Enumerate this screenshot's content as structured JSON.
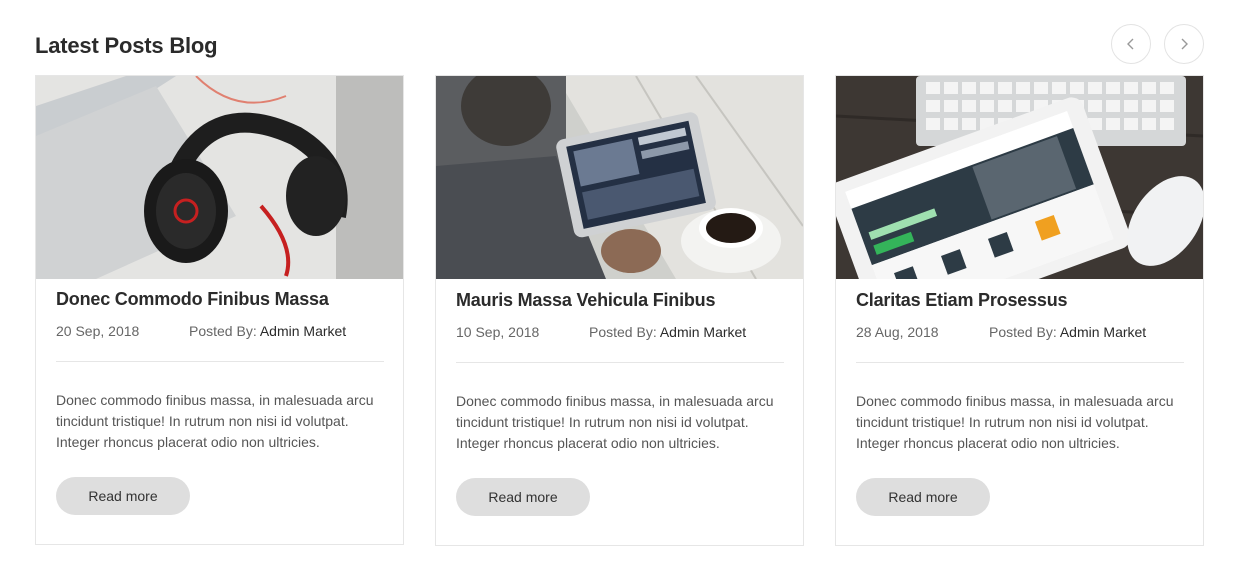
{
  "section": {
    "title": "Latest Posts Blog"
  },
  "nav": {
    "prev_icon": "chevron-left-icon",
    "next_icon": "chevron-right-icon"
  },
  "posts": [
    {
      "title": "Donec Commodo Finibus Massa",
      "date": "20 Sep, 2018",
      "posted_by_label": "Posted By: ",
      "author": "Admin Market",
      "excerpt": "Donec commodo finibus massa, in malesuada arcu tincidunt tristique! In rutrum non nisi id volutpat. Integer rhoncus placerat odio non ultricies.",
      "read_more": "Read more",
      "image": "headphones-photo"
    },
    {
      "title": "Mauris Massa Vehicula Finibus",
      "date": "10 Sep, 2018",
      "posted_by_label": "Posted By: ",
      "author": "Admin Market",
      "excerpt": "Donec commodo finibus massa, in malesuada arcu tincidunt tristique! In rutrum non nisi id volutpat. Integer rhoncus placerat odio non ultricies.",
      "read_more": "Read more",
      "image": "tablet-coffee-photo"
    },
    {
      "title": "Claritas Etiam Prosessus",
      "date": "28 Aug, 2018",
      "posted_by_label": "Posted By: ",
      "author": "Admin Market",
      "excerpt": "Donec commodo finibus massa, in malesuada arcu tincidunt tristique! In rutrum non nisi id volutpat. Integer rhoncus placerat odio non ultricies.",
      "read_more": "Read more",
      "image": "tablet-keyboard-photo"
    }
  ]
}
